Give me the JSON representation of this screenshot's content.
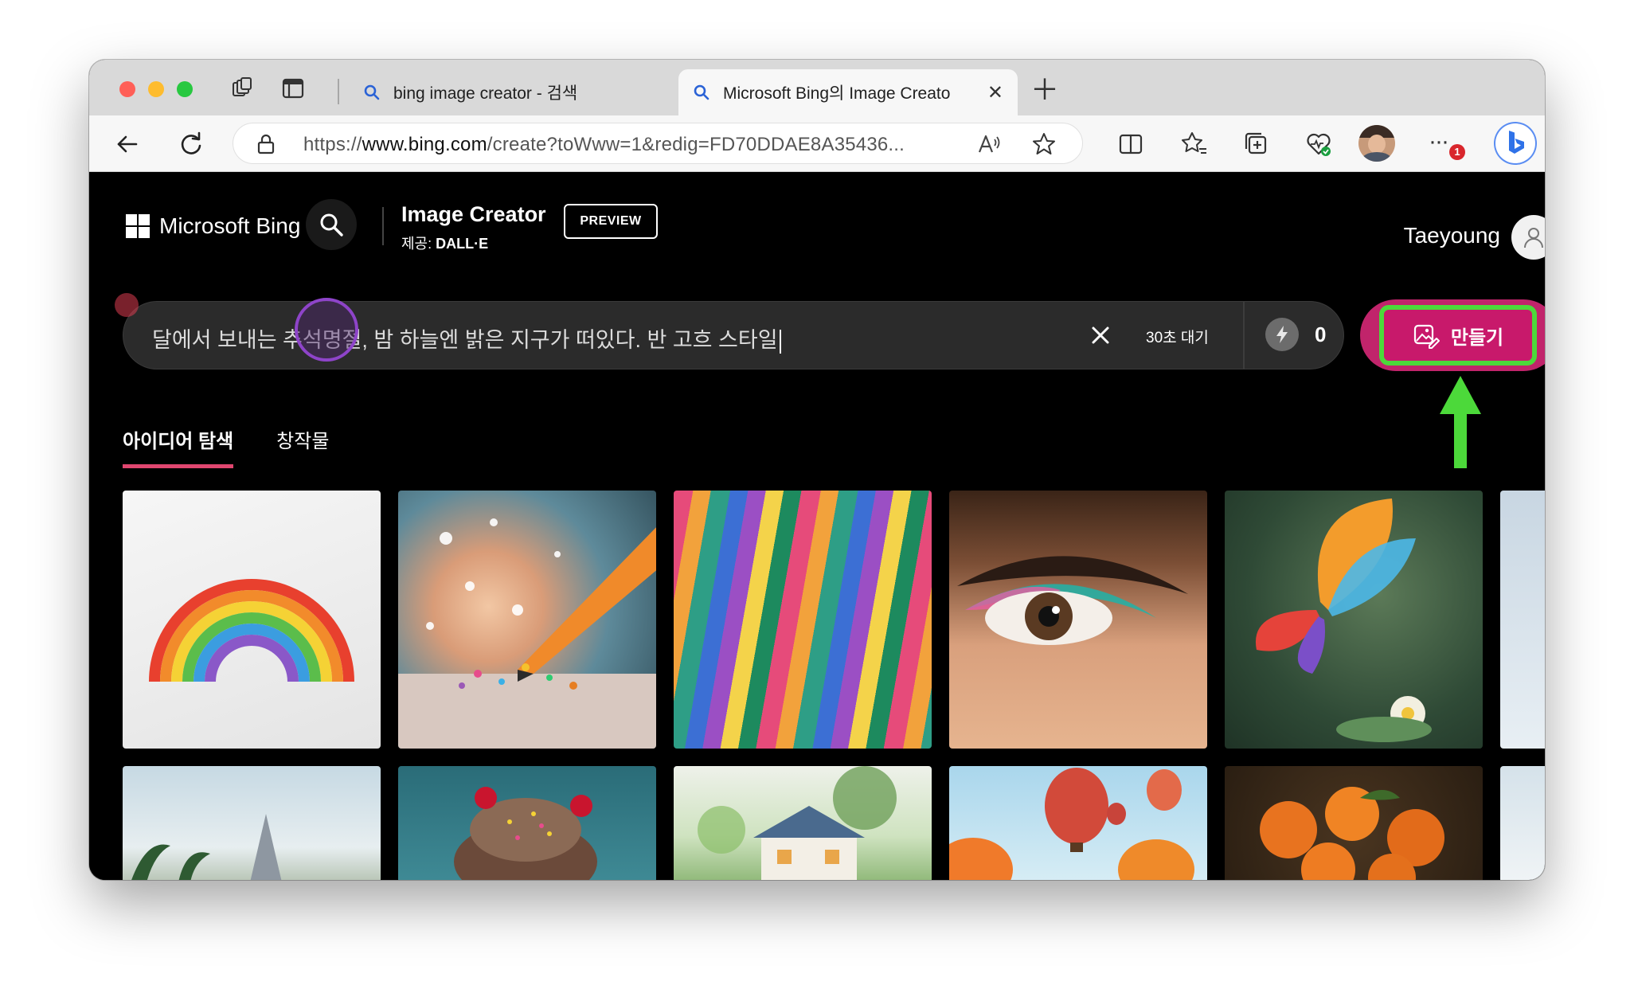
{
  "browser": {
    "tabs": [
      {
        "title": "bing image creator - 검색",
        "active": false
      },
      {
        "title": "Microsoft Bing의 Image Creato",
        "active": true
      }
    ],
    "url_prefix": "https://",
    "url_host": "www.bing.com",
    "url_path": "/create?toWww=1&redig=FD70DDAE8A35436...",
    "notification_badge": "1"
  },
  "header": {
    "brand": "Microsoft Bing",
    "product_title": "Image Creator",
    "product_sub_prefix": "제공: ",
    "product_sub_strong": "DALL·E",
    "preview_badge": "PREVIEW",
    "user_name": "Taeyoung"
  },
  "prompt": {
    "text": "달에서 보내는 추석명절, 밤 하늘엔 밝은 지구가 떠있다. 반 고흐 스타일",
    "wait_label": "30초 대기",
    "boost_count": "0",
    "create_label": "만들기"
  },
  "section_tabs": [
    {
      "label": "아이디어 탐색",
      "active": true
    },
    {
      "label": "창작물",
      "active": false
    }
  ],
  "gallery": {
    "row1": [
      "rainbow",
      "pencil-sparkles",
      "color-ribbons",
      "eye-makeup",
      "rainbow-butterfly",
      "partial"
    ],
    "row2": [
      "palm-beach",
      "sundae",
      "watercolor-house",
      "hot-air-balloons",
      "oranges",
      "partial"
    ]
  },
  "colors": {
    "create_button": "#c8196b",
    "annotation_green": "#4cd93a",
    "active_tab_underline": "#e0466f"
  }
}
